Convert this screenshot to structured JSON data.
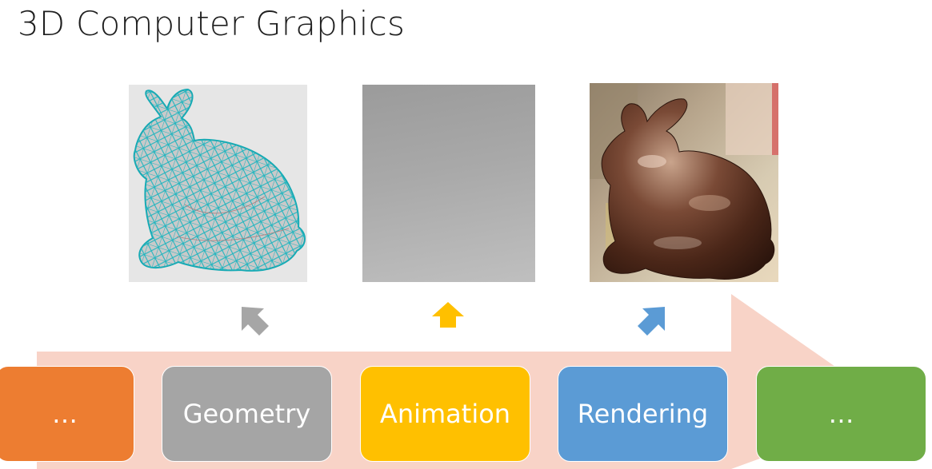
{
  "title": "3D Computer Graphics",
  "panels": [
    {
      "id": "geometry",
      "subject": "bunny-wireframe-mesh"
    },
    {
      "id": "animation",
      "subject": "gray-gradient-placeholder"
    },
    {
      "id": "rendering",
      "subject": "bunny-copper-render"
    }
  ],
  "pointer_arrows": [
    {
      "target": "geometry",
      "color": "#a6a6a6",
      "icon": "arrow-up-left-icon"
    },
    {
      "target": "animation",
      "color": "#ffc000",
      "icon": "arrow-up-icon"
    },
    {
      "target": "rendering",
      "color": "#5b9bd5",
      "icon": "arrow-up-right-icon"
    }
  ],
  "pipeline": {
    "band_color": "#f8d3c7",
    "stages": [
      {
        "label": "…",
        "color": "#ed7d31"
      },
      {
        "label": "Geometry",
        "color": "#a5a5a5"
      },
      {
        "label": "Animation",
        "color": "#ffc000"
      },
      {
        "label": "Rendering",
        "color": "#5b9bd5"
      },
      {
        "label": "…",
        "color": "#70ad47"
      }
    ]
  }
}
